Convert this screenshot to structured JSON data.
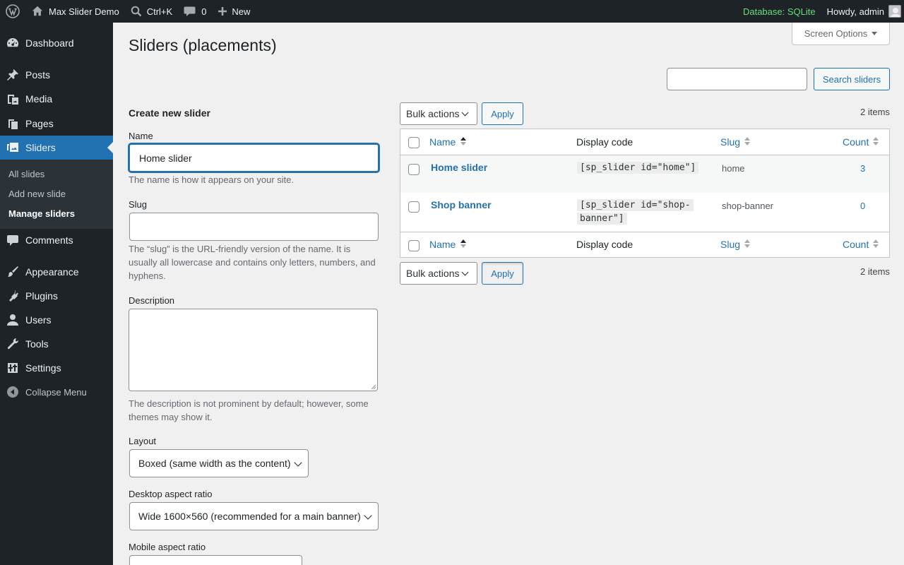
{
  "adminbar": {
    "site_name": "Max Slider Demo",
    "search_shortcut": "Ctrl+K",
    "comments_count": "0",
    "new_label": "New",
    "database_label": "Database: SQLite",
    "howdy": "Howdy, admin"
  },
  "menu": {
    "items": [
      {
        "label": "Dashboard",
        "icon": "dashboard-icon"
      },
      {
        "label": "Posts",
        "icon": "pin-icon"
      },
      {
        "label": "Media",
        "icon": "media-icon"
      },
      {
        "label": "Pages",
        "icon": "pages-icon"
      },
      {
        "label": "Sliders",
        "icon": "slides-icon"
      },
      {
        "label": "Comments",
        "icon": "comment-icon"
      },
      {
        "label": "Appearance",
        "icon": "brush-icon"
      },
      {
        "label": "Plugins",
        "icon": "plugin-icon"
      },
      {
        "label": "Users",
        "icon": "user-icon"
      },
      {
        "label": "Tools",
        "icon": "wrench-icon"
      },
      {
        "label": "Settings",
        "icon": "settings-icon"
      }
    ],
    "submenu": [
      "All slides",
      "Add new slide",
      "Manage sliders"
    ],
    "collapse_label": "Collapse Menu"
  },
  "screen_options_label": "Screen Options",
  "page_title": "Sliders (placements)",
  "search": {
    "value": "",
    "button_label": "Search sliders"
  },
  "form": {
    "title": "Create new slider",
    "name_label": "Name",
    "name_value": "Home slider",
    "name_help": "The name is how it appears on your site.",
    "slug_label": "Slug",
    "slug_value": "",
    "slug_help_1": "The “slug” is the URL-friendly version of the name. It is",
    "slug_help_2": "usually all lowercase and contains only letters, numbers, and",
    "slug_help_3": "hyphens.",
    "description_label": "Description",
    "description_help_1": "The description is not prominent by default; however, some",
    "description_help_2": "themes may show it.",
    "layout_label": "Layout",
    "layout_value": "Boxed (same width as the content)",
    "desktop_ratio_label": "Desktop aspect ratio",
    "desktop_ratio_value": "Wide 1600×560 (recommended for a main banner)",
    "mobile_ratio_label": "Mobile aspect ratio"
  },
  "table": {
    "bulk_actions_label": "Bulk actions",
    "apply_label": "Apply",
    "items_count": "2 items",
    "columns": {
      "name": "Name",
      "display_code": "Display code",
      "slug": "Slug",
      "count": "Count"
    },
    "rows": [
      {
        "name": "Home slider",
        "code_line1": "[sp_slider id=\"home\"]",
        "code_line2": "",
        "slug": "home",
        "count": "3"
      },
      {
        "name": "Shop banner",
        "code_line1": "[sp_slider id=\"shop-",
        "code_line2": "banner\"]",
        "slug": "shop-banner",
        "count": "0"
      }
    ]
  }
}
